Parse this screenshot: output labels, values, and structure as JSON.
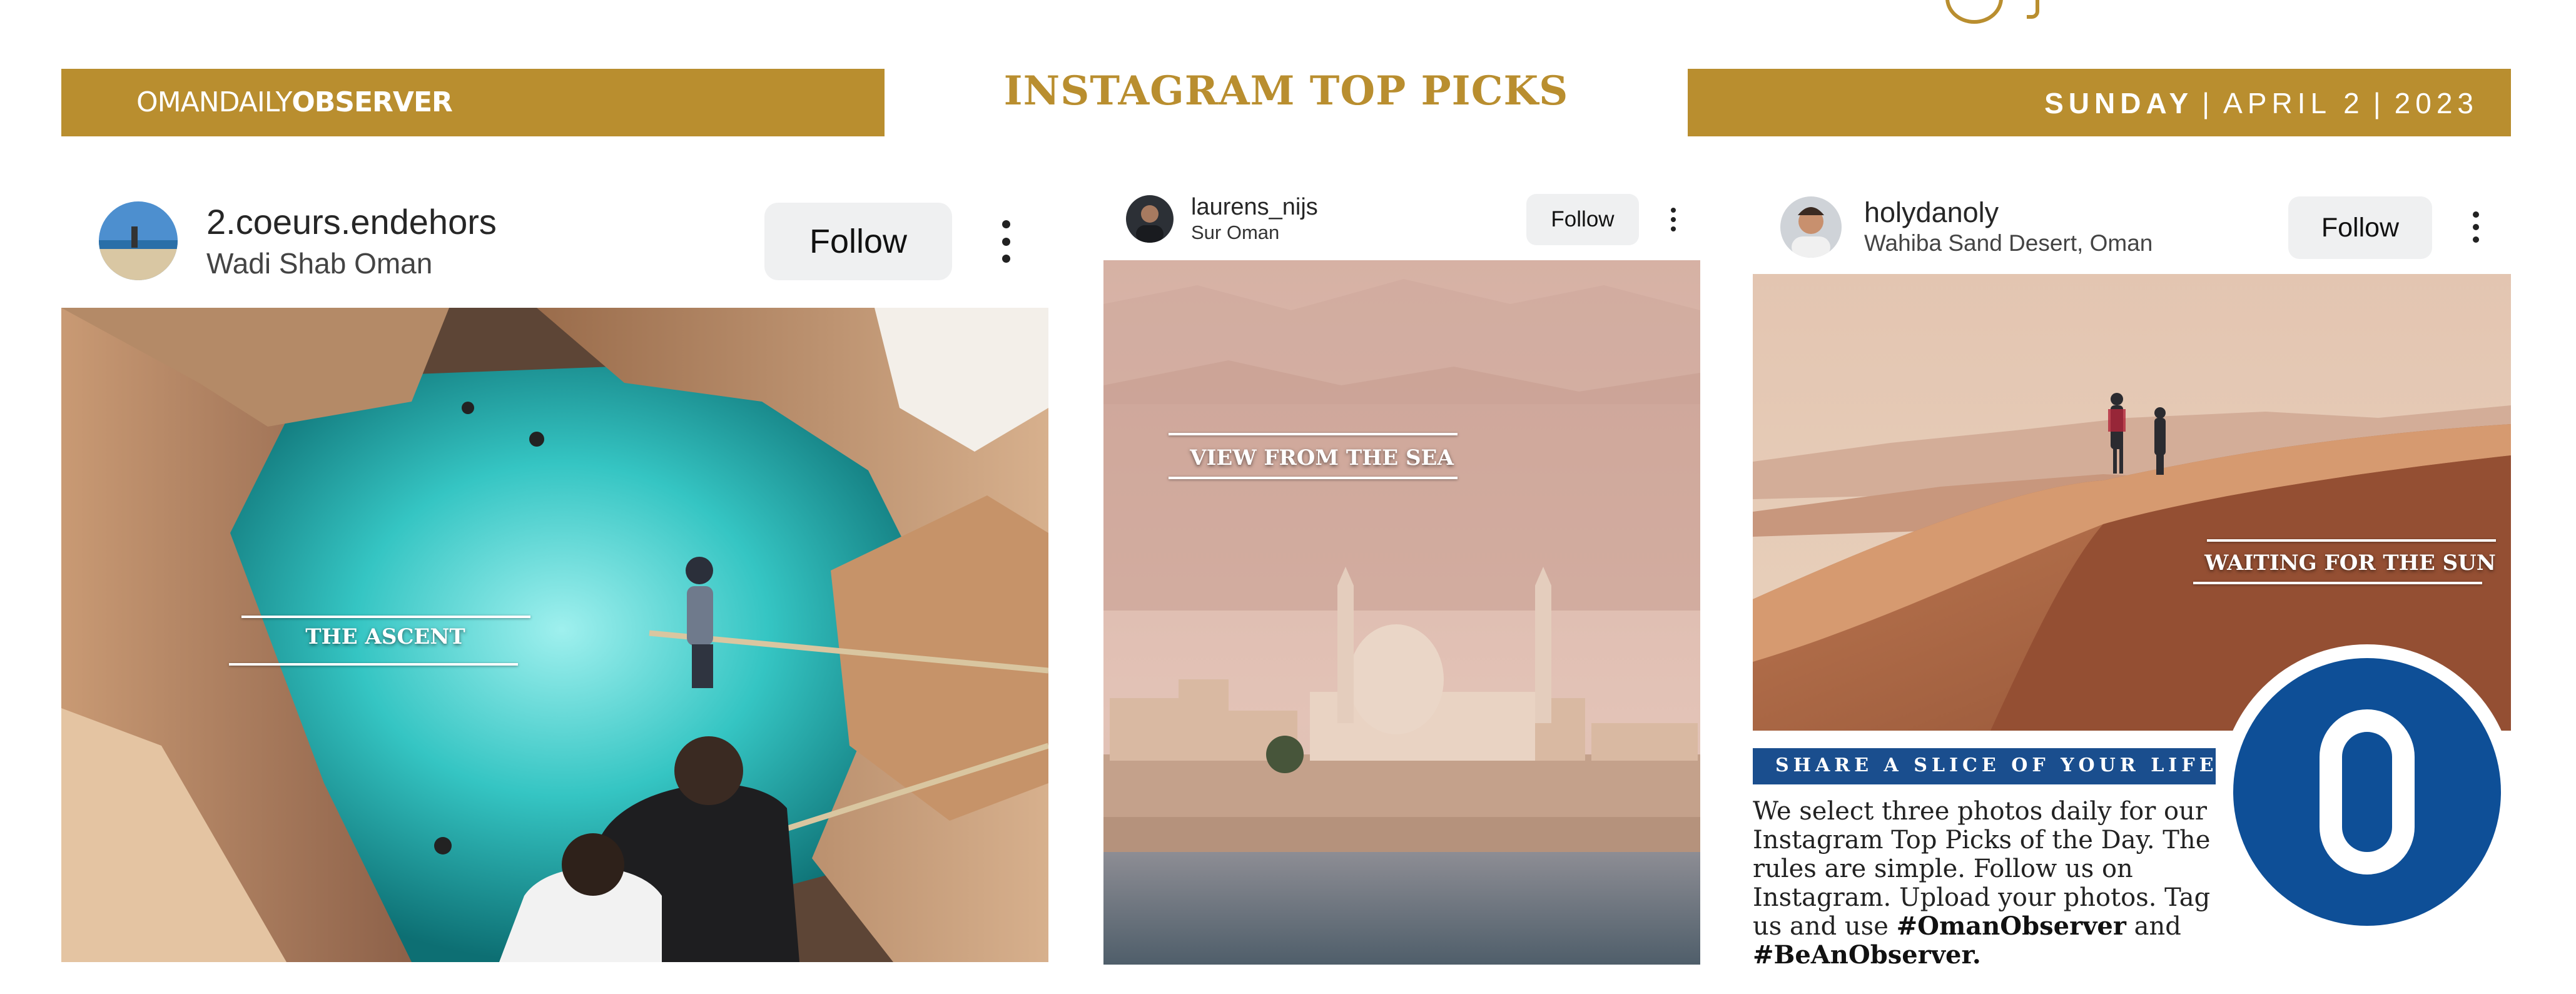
{
  "header": {
    "brand_light": "OMANDAILY",
    "brand_bold": "OBSERVER",
    "title": "INSTAGRAM TOP PICKS",
    "date_day": "SUNDAY",
    "date_sep": "|",
    "date_month_day": "APRIL 2",
    "date_year": "2023"
  },
  "posts": [
    {
      "username": "2.coeurs.endehors",
      "location": "Wadi Shab Oman",
      "follow_label": "Follow",
      "caption": "THE ASCENT"
    },
    {
      "username": "laurens_nijs",
      "location": "Sur Oman",
      "follow_label": "Follow",
      "caption": "VIEW FROM THE SEA"
    },
    {
      "username": "holydanoly",
      "location": "Wahiba Sand Desert, Oman",
      "follow_label": "Follow",
      "caption": "WAITING FOR THE SUN"
    }
  ],
  "share": {
    "heading": "SHARE A SLICE OF YOUR LIFE",
    "body": "We select three photos daily for our Instagram Top Picks of the Day. The rules are simple. Follow us on Instagram. Upload your photos. Tag us and use",
    "hashtag1": "#OmanObserver",
    "and": "and",
    "hashtag2": "#BeAnObserver."
  },
  "logo": {
    "letter": "O"
  },
  "colors": {
    "gold": "#b98e2f",
    "navy": "#1a4e8e",
    "logo_blue": "#0e4f97"
  }
}
